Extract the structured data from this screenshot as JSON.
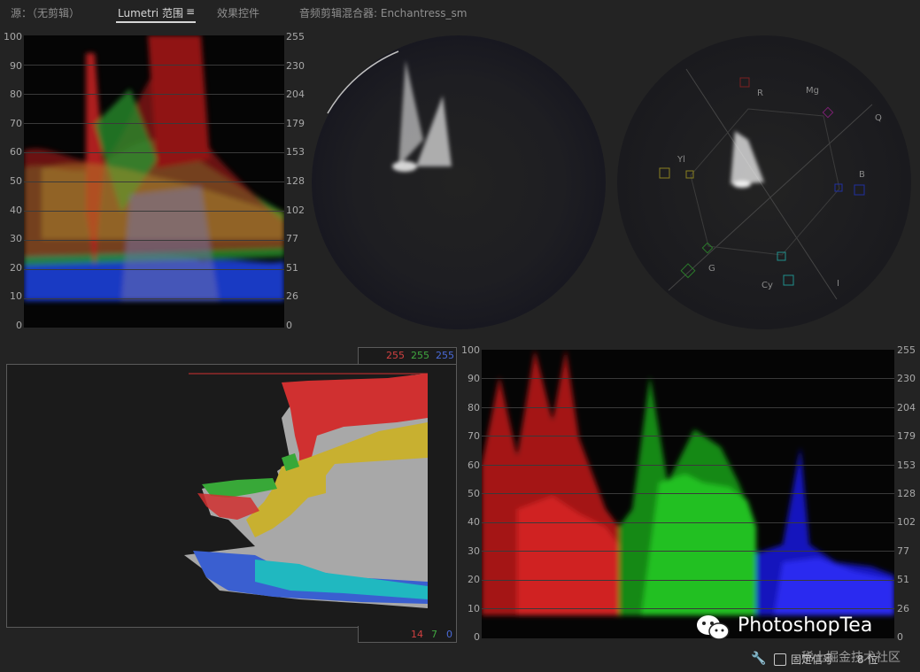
{
  "tabs": {
    "source": "源：（无剪辑）",
    "lumetri": "Lumetri 范围",
    "lumetri_menu": "≡",
    "effect_controls": "效果控件",
    "audio_mixer": "音频剪辑混合器: Enchantress_sm"
  },
  "waveform_rgb": {
    "left_ticks": [
      "100",
      "90",
      "80",
      "70",
      "60",
      "50",
      "40",
      "30",
      "20",
      "10",
      "0"
    ],
    "right_ticks": [
      "255",
      "230",
      "204",
      "179",
      "153",
      "128",
      "102",
      "77",
      "51",
      "26",
      "0"
    ]
  },
  "vectorscope_hls": {},
  "vectorscope_yuv": {
    "targets": [
      "R",
      "Mg",
      "B",
      "Cy",
      "G",
      "Yl"
    ],
    "extra_label": "Q",
    "extra_label2": "I"
  },
  "histogram": {
    "top_values": {
      "red": "255",
      "green": "255",
      "blue": "255"
    },
    "bottom_values": {
      "red": "14",
      "green": "7",
      "blue": "0"
    },
    "colors": {
      "red": "#d03030",
      "green": "#38a838",
      "blue": "#3a5fd0",
      "yellow": "#c8b030",
      "cyan": "#20b8c0",
      "gray": "#a8a8a8"
    }
  },
  "parade": {
    "left_ticks": [
      "100",
      "90",
      "80",
      "70",
      "60",
      "50",
      "40",
      "30",
      "20",
      "10",
      "0"
    ],
    "right_ticks": [
      "255",
      "230",
      "204",
      "179",
      "153",
      "128",
      "102",
      "77",
      "51",
      "26",
      "0"
    ]
  },
  "footer": {
    "wrench_icon": "wrench-icon",
    "clamp_label": "固定信号",
    "bit_label": "8 位",
    "watermark": "PhotoshopTea",
    "watermark_site": "稀土掘金技术社区"
  }
}
